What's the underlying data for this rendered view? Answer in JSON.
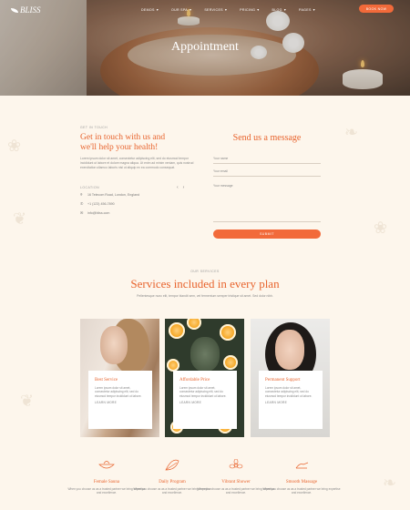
{
  "header": {
    "logo": "BLISS",
    "nav": [
      {
        "label": "DEMOS"
      },
      {
        "label": "OUR SPA"
      },
      {
        "label": "SERVICES"
      },
      {
        "label": "PRICING"
      },
      {
        "label": "BLOG"
      },
      {
        "label": "PAGES"
      }
    ],
    "book_button": "BOOK NOW"
  },
  "hero": {
    "title": "Appointment"
  },
  "contact": {
    "eyebrow": "GET IN TOUCH",
    "heading_line1": "Get in touch with us and",
    "heading_line2": "we'll help your health!",
    "description": "Lorem ipsum dolor sit amet, consectetur adipiscing elit, sed do eiusmod tempor incididunt ut labore et dolore magna aliqua. Ut enim ad minim veniam, quis nostrud exercitation ullamco laboris nisi ut aliquip ex ea commodo consequat.",
    "location_label": "LOCATION",
    "address": "16 Telecom Road, London, England",
    "phone": "+1 (123) 456-7890",
    "email": "info@bliss.com"
  },
  "form": {
    "title": "Send us a message",
    "name_placeholder": "Your name",
    "email_placeholder": "Your email",
    "message_placeholder": "Your message",
    "submit_label": "SUBMIT"
  },
  "services": {
    "eyebrow": "OUR SERVICES",
    "title": "Services included in every plan",
    "description": "Pellentesque nunc elit, tempor blandit sem, vel fermentum semper tristique sit amet. Sed dolor nibh.",
    "cards": [
      {
        "title": "Best Service",
        "text": "Lorem ipsum dolor sit amet, consectetur adipiscing elit, sed do eiusmod tempor incididunt ut labore.",
        "link": "LEARN MORE"
      },
      {
        "title": "Affordable Price",
        "text": "Lorem ipsum dolor sit amet, consectetur adipiscing elit, sed do eiusmod tempor incididunt ut labore.",
        "link": "LEARN MORE"
      },
      {
        "title": "Permanent Support",
        "text": "Lorem ipsum dolor sit amet, consectetur adipiscing elit, sed do eiusmod tempor incididunt ut labore.",
        "link": "LEARN MORE"
      }
    ]
  },
  "features": [
    {
      "title": "Female Sauna",
      "text": "When you choose us as a trusted partner we bring expertise and excellence.",
      "icon": "bowl-icon"
    },
    {
      "title": "Daily Program",
      "text": "When you choose us as a trusted partner we bring expertise and excellence.",
      "icon": "leaf-icon"
    },
    {
      "title": "Vibrant Shower",
      "text": "When you choose us as a trusted partner we bring expertise and excellence.",
      "icon": "flower-icon"
    },
    {
      "title": "Smooth Massage",
      "text": "When you choose us as a trusted partner we bring expertise and excellence.",
      "icon": "hand-icon"
    }
  ],
  "colors": {
    "accent": "#e8642e",
    "button": "#f26a3a",
    "background": "#fdf6ec"
  }
}
